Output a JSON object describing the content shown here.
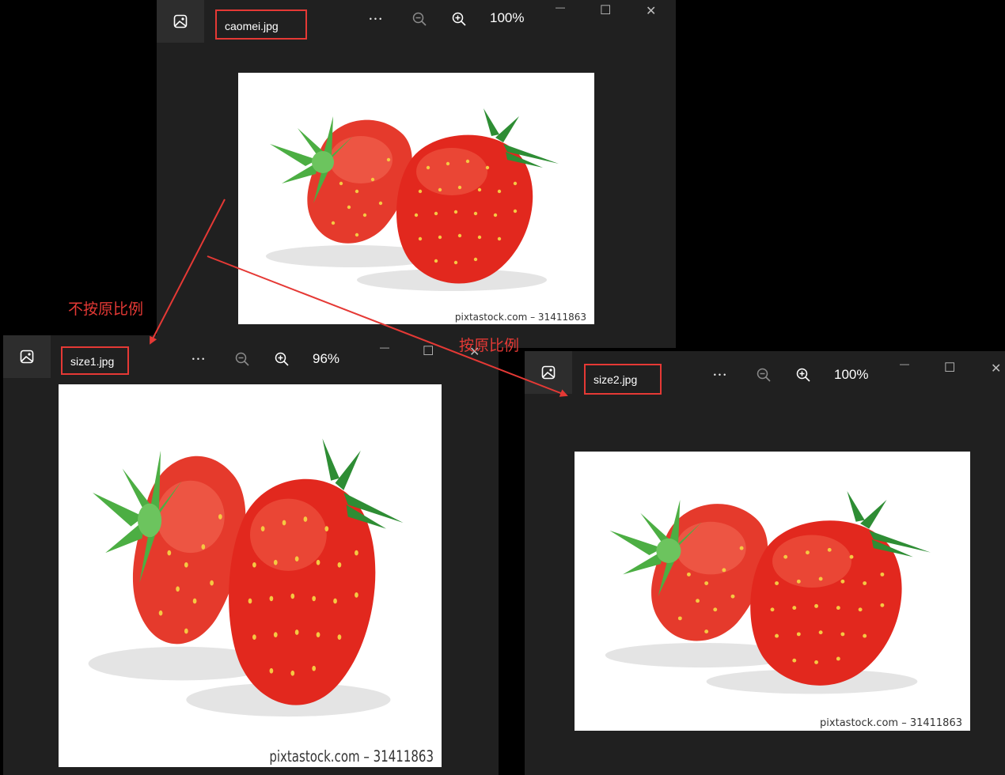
{
  "windows": {
    "original": {
      "filename": "caomei.jpg",
      "zoom": "100%",
      "credit": "pixtastock.com – 31411863"
    },
    "size1": {
      "filename": "size1.jpg",
      "zoom": "96%",
      "credit": "pixtastock.com – 31411863"
    },
    "size2": {
      "filename": "size2.jpg",
      "zoom": "100%",
      "credit": "pixtastock.com – 31411863"
    }
  },
  "toolbar": {
    "more_glyph": "•••",
    "minimize_glyph": "—",
    "maximize_glyph": "☐",
    "close_glyph": "✕"
  },
  "annotations": {
    "not_keep_ratio": "不按原比例",
    "keep_ratio": "按原比例"
  },
  "colors": {
    "highlight_box": "#e53935",
    "arrow": "#e53935",
    "window_bg": "#202020"
  }
}
